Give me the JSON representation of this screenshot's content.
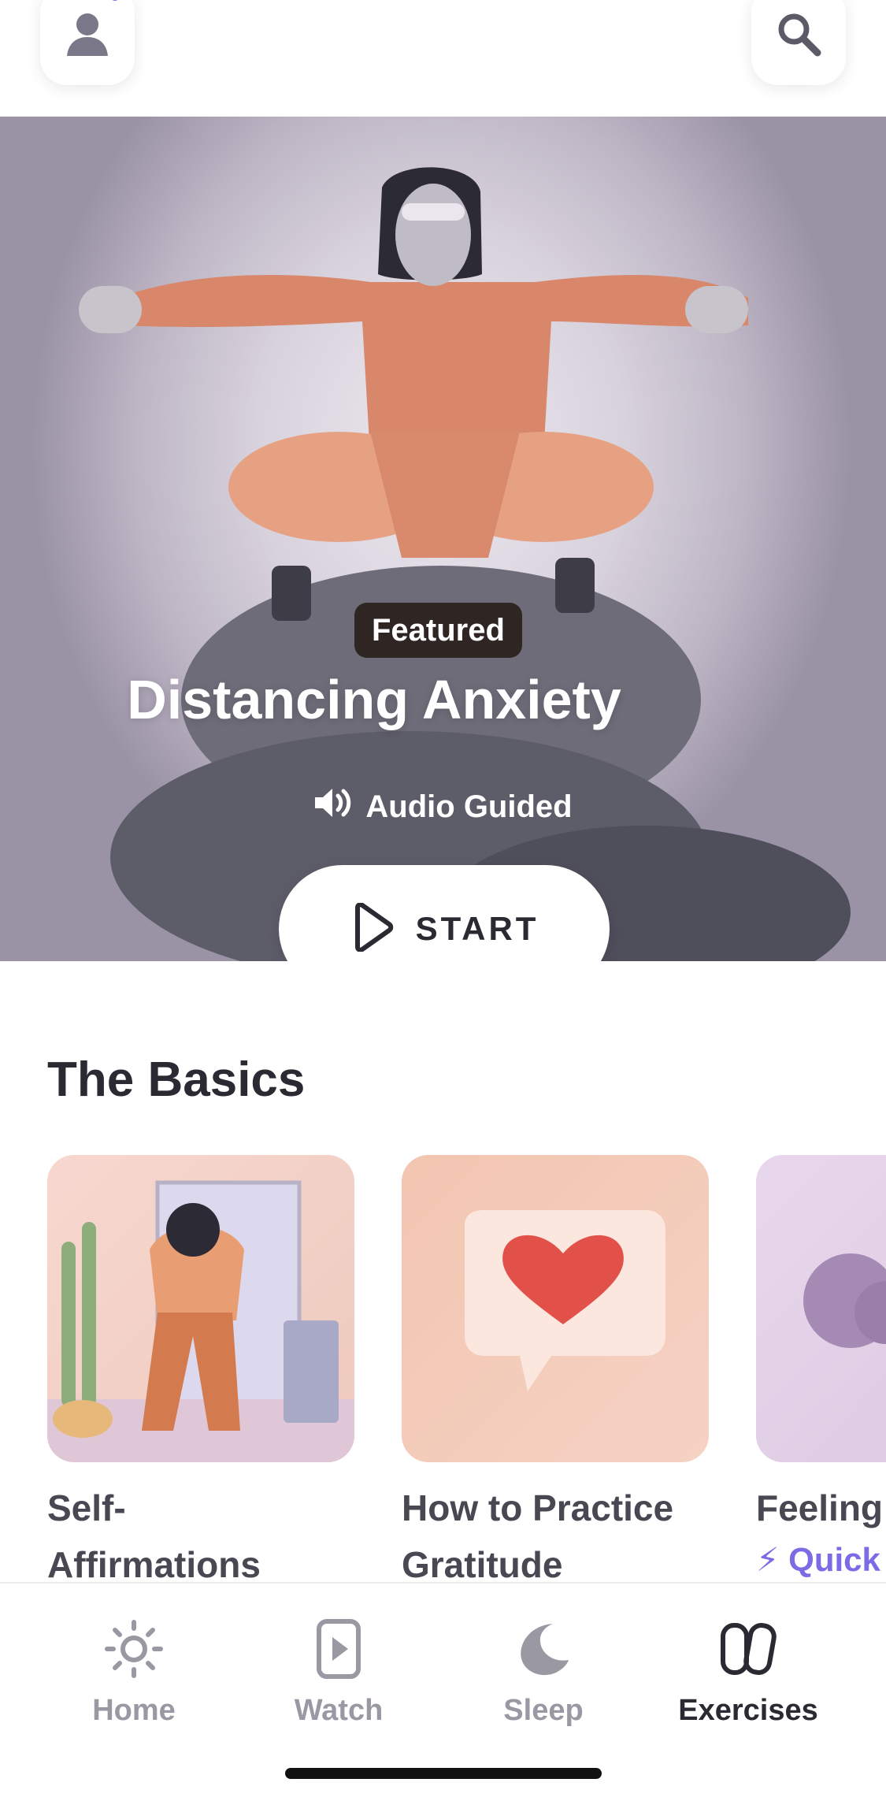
{
  "header": {
    "profile_icon": "person-icon",
    "search_icon": "search-icon",
    "notification_color": "#7b6ce6"
  },
  "hero": {
    "badge": "Featured",
    "title": "Distancing Anxiety",
    "audio_icon": "speaker-icon",
    "audio_label": "Audio Guided",
    "start_label": "START"
  },
  "basics": {
    "title": "The Basics",
    "items": [
      {
        "label_line1": "Self-",
        "label_line2": "Affirmations"
      },
      {
        "label_line1": "How to Practice",
        "label_line2": "Gratitude"
      },
      {
        "label_line1": "Feeling",
        "tag": "Quick"
      }
    ]
  },
  "tabbar": {
    "items": [
      {
        "label": "Home",
        "icon": "sun-icon",
        "active": false
      },
      {
        "label": "Watch",
        "icon": "play-card-icon",
        "active": false
      },
      {
        "label": "Sleep",
        "icon": "moon-icon",
        "active": false
      },
      {
        "label": "Exercises",
        "icon": "exercises-icon",
        "active": true
      }
    ]
  },
  "colors": {
    "accent": "#7b6ce6",
    "text": "#2b2a33"
  }
}
